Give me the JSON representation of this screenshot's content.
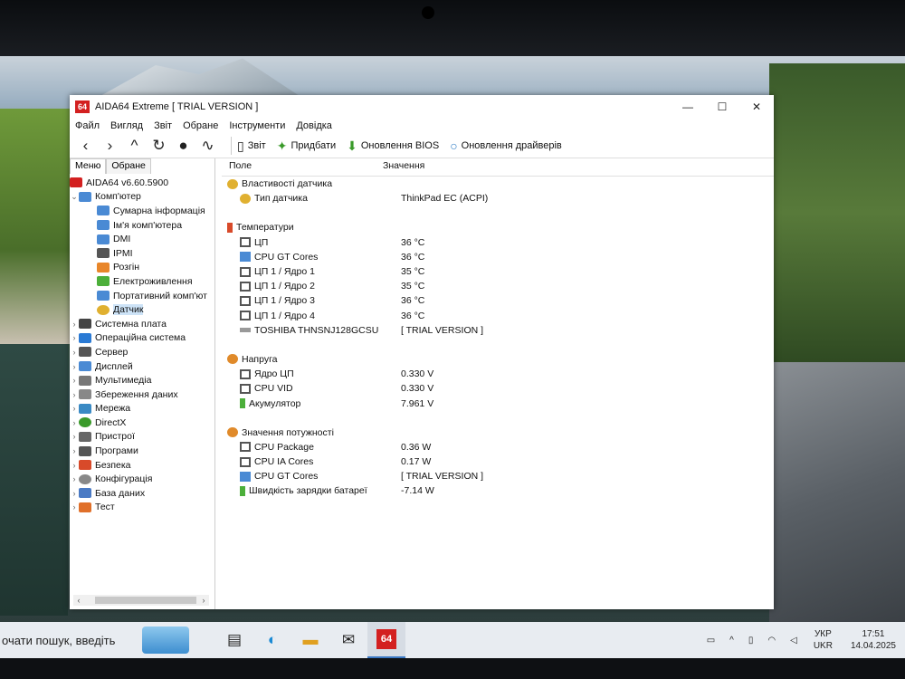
{
  "window": {
    "title": "AIDA64 Extreme  [ TRIAL VERSION ]",
    "app_icon": "64",
    "menu": [
      "Файл",
      "Вигляд",
      "Звіт",
      "Обране",
      "Інструменти",
      "Довідка"
    ],
    "toolbar": {
      "nav_icons": [
        "back-icon",
        "forward-icon",
        "up-icon",
        "refresh-icon",
        "user-icon",
        "chart-icon"
      ],
      "buttons": [
        {
          "label": "Звіт",
          "icon": "report-icon"
        },
        {
          "label": "Придбати",
          "icon": "buy-icon"
        },
        {
          "label": "Оновлення BIOS",
          "icon": "bios-update-icon"
        },
        {
          "label": "Оновлення драйверів",
          "icon": "driver-update-icon"
        }
      ]
    }
  },
  "sidebar": {
    "tabs": [
      "Меню",
      "Обране"
    ],
    "root": "AIDA64 v6.60.5900",
    "computer": "Комп'ютер",
    "computer_children": [
      "Сумарна інформація",
      "Ім'я комп'ютера",
      "DMI",
      "IPMI",
      "Розгін",
      "Електроживлення",
      "Портативний комп'ют",
      "Датчик"
    ],
    "top_nodes": [
      "Системна плата",
      "Операційна система",
      "Сервер",
      "Дисплей",
      "Мультимедіа",
      "Збереження даних",
      "Мережа",
      "DirectX",
      "Пристрої",
      "Програми",
      "Безпека",
      "Конфігурація",
      "База даних",
      "Тест"
    ]
  },
  "table": {
    "col_field": "Поле",
    "col_value": "Значення",
    "g1": {
      "title": "Властивості датчика",
      "rows": [
        {
          "f": "Тип датчика",
          "v": "ThinkPad EC  (ACPI)"
        }
      ]
    },
    "g2": {
      "title": "Температури",
      "rows": [
        {
          "f": "ЦП",
          "v": "36 °C"
        },
        {
          "f": "CPU GT Cores",
          "v": "36 °C"
        },
        {
          "f": "ЦП 1 / Ядро 1",
          "v": "35 °C"
        },
        {
          "f": "ЦП 1 / Ядро 2",
          "v": "35 °C"
        },
        {
          "f": "ЦП 1 / Ядро 3",
          "v": "36 °C"
        },
        {
          "f": "ЦП 1 / Ядро 4",
          "v": "36 °C"
        },
        {
          "f": "TOSHIBA THNSNJ128GCSU",
          "v": "[ TRIAL VERSION ]"
        }
      ]
    },
    "g3": {
      "title": "Напруга",
      "rows": [
        {
          "f": "Ядро ЦП",
          "v": "0.330 V"
        },
        {
          "f": "CPU VID",
          "v": "0.330 V"
        },
        {
          "f": "Акумулятор",
          "v": "7.961 V"
        }
      ]
    },
    "g4": {
      "title": "Значення потужності",
      "rows": [
        {
          "f": "CPU Package",
          "v": "0.36 W"
        },
        {
          "f": "CPU IA Cores",
          "v": "0.17 W"
        },
        {
          "f": "CPU GT Cores",
          "v": "[ TRIAL VERSION ]"
        },
        {
          "f": "Швидкість зарядки батареї",
          "v": "-7.14 W"
        }
      ]
    }
  },
  "taskbar": {
    "search_text": "очати пошук, введіть",
    "aida_label": "64",
    "lang_top": "УКР",
    "lang_bottom": "UKR",
    "time": "17:51",
    "date": "14.04.2025"
  }
}
